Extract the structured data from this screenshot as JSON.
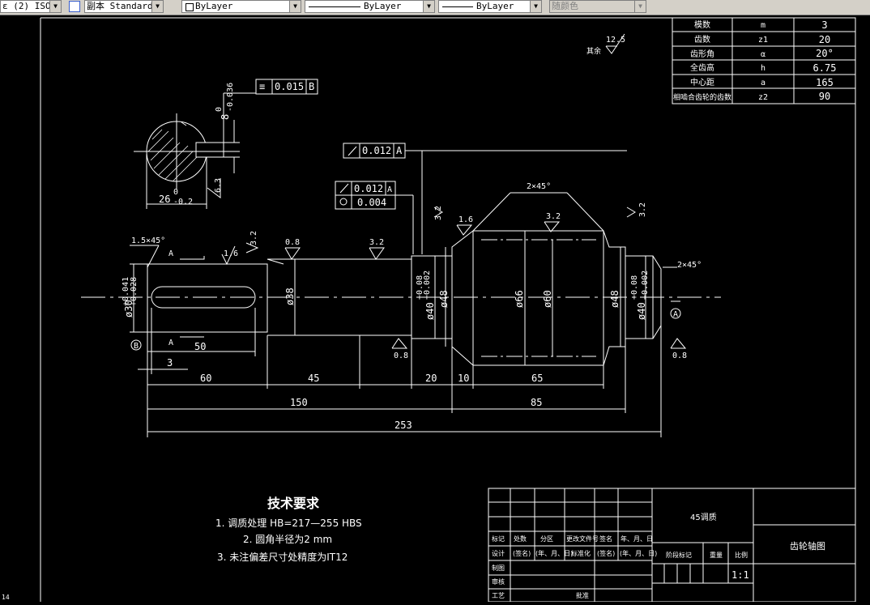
{
  "toolbar": {
    "dimstyle": "ε (2) ISO-",
    "textstyle": "副本 Standard(",
    "layer": "ByLayer",
    "linetype": "ByLayer",
    "lineweight": "ByLayer",
    "color": "随颜色"
  },
  "param_table": [
    {
      "name": "模数",
      "sym": "m",
      "val": "3"
    },
    {
      "name": "齿数",
      "sym": "z1",
      "val": "20"
    },
    {
      "name": "齿形角",
      "sym": "α",
      "val": "20°"
    },
    {
      "name": "全齿高",
      "sym": "h",
      "val": "6.75"
    },
    {
      "name": "中心距",
      "sym": "a",
      "val": "165"
    },
    {
      "name": "相啮合齿轮的齿数",
      "sym": "z2",
      "val": "90"
    }
  ],
  "roughness": {
    "rest_label": "其余",
    "rest_value": "12.5",
    "r32": "3.2",
    "r16": "1.6",
    "r08": "0.8",
    "r63": "6.3"
  },
  "section": {
    "tol_symbol": "≡",
    "tol_value": "0.015",
    "tol_datum": "B",
    "width_dim": "8",
    "width_up": "0",
    "width_low": "-0.036",
    "depth_dim": "26",
    "depth_up": "0",
    "depth_low": "-0.2"
  },
  "fcf": {
    "runout_value": "0.012",
    "runout_datum": "A",
    "cyl_value": "0.004"
  },
  "dims": {
    "chamfer_left": "1.5×45°",
    "chamfer_gear": "2×45°",
    "chamfer_right": "2×45°",
    "d30": "ø30",
    "d30_up": "+0.041",
    "d30_low": "+0.028",
    "d38": "ø38",
    "d40": "ø40",
    "d40_up": "+0.08",
    "d40_low": "+0.002",
    "d48": "ø48",
    "d66": "ø66",
    "d60": "ø60",
    "key_len": "50",
    "key_off": "3",
    "l60": "60",
    "l45": "45",
    "l20": "20",
    "l10": "10",
    "l65": "65",
    "l150": "150",
    "l85": "85",
    "l253": "253",
    "sec_a": "A",
    "datum_a": "A",
    "datum_b": "B"
  },
  "tech": {
    "title": "技术要求",
    "req1": "1.  调质处理  HB=217—255 HBS",
    "req2": "2.  圆角半径为2 mm",
    "req3": "3.  未注偏差尺寸处精度为IT12"
  },
  "title_block": {
    "material": "45调质",
    "drawing_name": "齿轮轴图",
    "mark": "标记",
    "count": "处数",
    "zone": "分区",
    "doc_no": "更改文件号",
    "sign": "签名",
    "date": "年、月、日",
    "design": "设计",
    "sign_bracket": "(签名)",
    "date_bracket": "(年、月、日)",
    "standard": "标准化",
    "drafting": "制图",
    "review": "审核",
    "process": "工艺",
    "approve": "批准",
    "stage": "阶段标记",
    "weight": "重量",
    "scale_label": "比例",
    "scale": "1:1"
  },
  "corner_mark": "14"
}
